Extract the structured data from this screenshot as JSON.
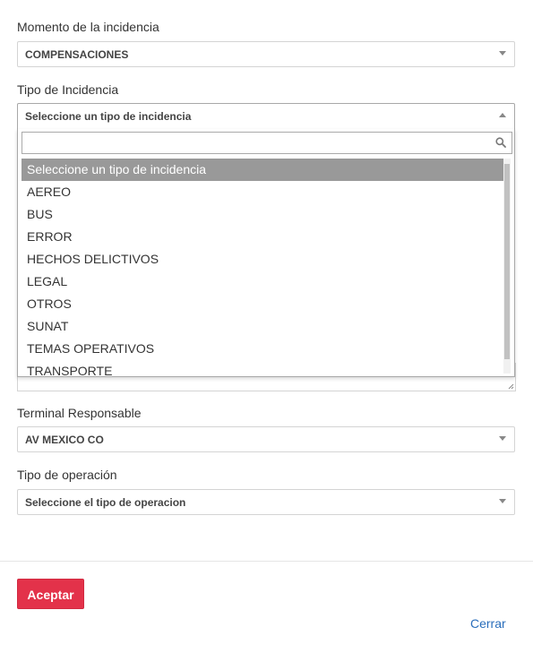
{
  "fields": {
    "momento": {
      "label": "Momento de la incidencia",
      "value": "COMPENSACIONES"
    },
    "tipo_incidencia": {
      "label": "Tipo de Incidencia",
      "value": "Seleccione un tipo de incidencia",
      "search_placeholder": "",
      "options": [
        "Seleccione un tipo de incidencia",
        "AEREO",
        "BUS",
        "ERROR",
        "HECHOS DELICTIVOS",
        "LEGAL",
        "OTROS",
        "SUNAT",
        "TEMAS OPERATIVOS",
        "TRANSPORTE"
      ],
      "selected_index": 0
    },
    "terminal": {
      "label": "Terminal Responsable",
      "value": "AV MEXICO CO"
    },
    "tipo_operacion": {
      "label": "Tipo de operación",
      "value": "Seleccione el tipo de operacion"
    }
  },
  "footer": {
    "accept_label": "Aceptar",
    "close_label": "Cerrar"
  },
  "colors": {
    "accent": "#e3324a",
    "link": "#2a6ebb",
    "selected_option": "#999999"
  },
  "icons": {
    "search": "search-icon",
    "dropdown_arrow": "chevron-down-icon",
    "dropdown_arrow_open": "chevron-up-icon"
  }
}
